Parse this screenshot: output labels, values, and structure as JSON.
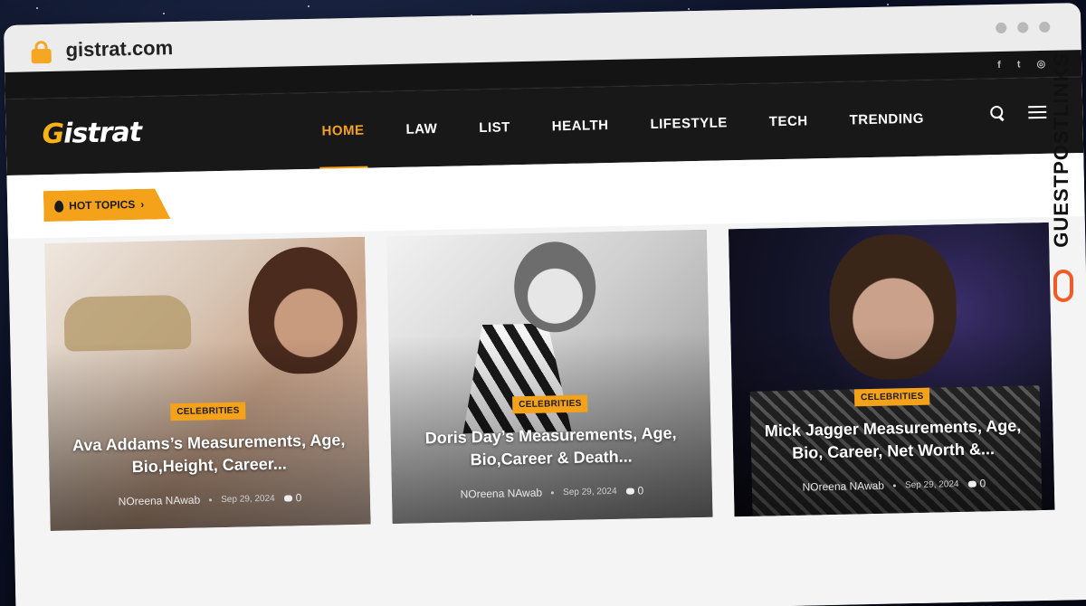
{
  "browser": {
    "url": "gistrat.com"
  },
  "topbar": {
    "socials": [
      {
        "icon": "facebook-icon",
        "label": "f"
      },
      {
        "icon": "twitter-icon",
        "label": "t"
      },
      {
        "icon": "instagram-icon",
        "label": "◎"
      }
    ]
  },
  "header": {
    "logo_g": "G",
    "logo_rest": "istrat",
    "nav": [
      "HOME",
      "LAW",
      "LIST",
      "HEALTH",
      "LIFESTYLE",
      "TECH",
      "TRENDING"
    ],
    "active_nav": "HOME"
  },
  "hot_topics": {
    "label": "HOT TOPICS",
    "chevron": "›"
  },
  "cards": [
    {
      "category": "CELEBRITIES",
      "title": "Ava Addams’s Measurements, Age, Bio,Height, Career...",
      "author": "NOreena NAwab",
      "date": "Sep 29, 2024",
      "comments": "0"
    },
    {
      "category": "CELEBRITIES",
      "title": "Doris Day’s Measurements, Age, Bio,Career & Death...",
      "author": "NOreena NAwab",
      "date": "Sep 29, 2024",
      "comments": "0"
    },
    {
      "category": "CELEBRITIES",
      "title": "Mick Jagger Measurements, Age, Bio, Career, Net Worth &...",
      "author": "NOreena NAwab",
      "date": "Sep 29, 2024",
      "comments": "0"
    }
  ],
  "watermark": {
    "part1": "GUESTPOST",
    "part2": "LINKS"
  },
  "colors": {
    "accent": "#f5a21b",
    "nav_bg": "#181818",
    "watermark_accent": "#f05a28"
  }
}
